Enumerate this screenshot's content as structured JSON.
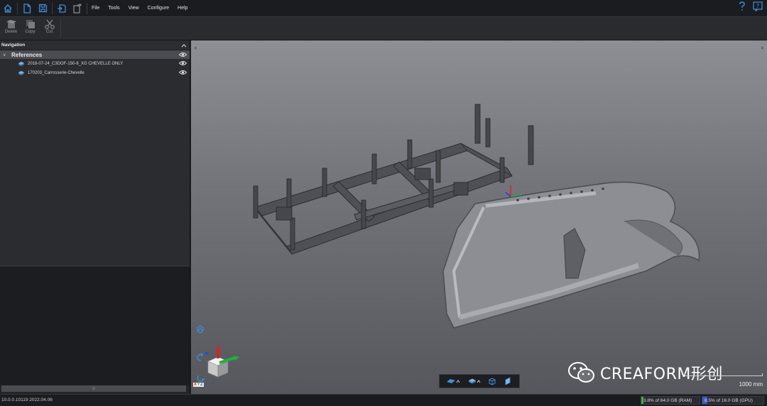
{
  "menu": {
    "items": [
      "File",
      "Tools",
      "View",
      "Configure",
      "Help"
    ]
  },
  "toolbar": {
    "delete_label": "Delete",
    "copy_label": "Copy",
    "cut_label": "Cut"
  },
  "navigation": {
    "title": "Navigation",
    "root": "References",
    "items": [
      "2018-07-24_C3DOF-150-8_XG CHEVELLE ONLY",
      "170203_Carrosserie-Chevelle"
    ]
  },
  "viewport": {
    "watermark": "CREAFORM形创",
    "scale_label": "1000 mm",
    "axes_label_x": "X",
    "axes_label_y": "Y",
    "axes_label_z": "Z"
  },
  "status": {
    "version": "10.0.0.10119 2022.04.06",
    "ram_text": "3.8% of 64.0 GB (RAM)",
    "ram_fraction": 0.038,
    "gpu_text": "8.5% of 16.0 GB (GPU)",
    "gpu_fraction": 0.085
  },
  "colors": {
    "accent_blue": "#3d8fe0",
    "ram_meter": "#3cb043",
    "gpu_meter": "#3f55d8"
  },
  "icons": {
    "home": "home-icon",
    "new": "new-file-icon",
    "save": "save-icon",
    "import": "import-icon",
    "export": "export-icon",
    "help": "help-icon",
    "whats_new": "whats-new-icon"
  }
}
